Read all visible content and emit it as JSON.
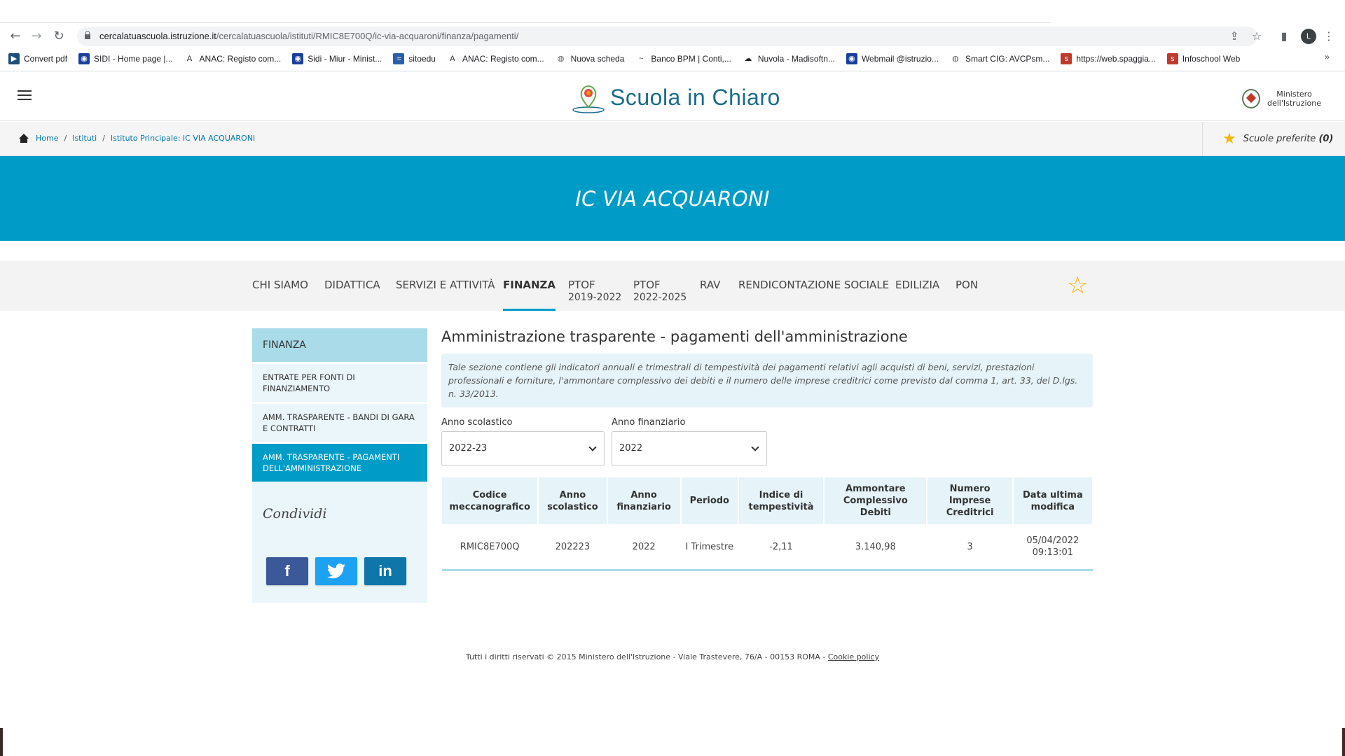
{
  "browser": {
    "url_host": "cercalatuascuola.istruzione.it",
    "url_path": "/cercalatuascuola/istituti/RMIC8E700Q/ic-via-acquaroni/finanza/pagamenti/",
    "profile_initial": "L",
    "bookmarks": [
      {
        "label": "Convert pdf",
        "icon": "convert-pdf-icon",
        "color": "#1f4e79"
      },
      {
        "label": "SIDI - Home page |...",
        "icon": "sidi-icon",
        "color": "#1a3f9a"
      },
      {
        "label": "ANAC: Registo com...",
        "icon": "anac-icon",
        "color": "#222222"
      },
      {
        "label": "Sidi - Miur - Minist...",
        "icon": "sidi-icon",
        "color": "#1a3f9a"
      },
      {
        "label": "sitoedu",
        "icon": "sitoedu-icon",
        "color": "#2a5ea8"
      },
      {
        "label": "ANAC: Registo com...",
        "icon": "anac-icon",
        "color": "#222222"
      },
      {
        "label": "Nuova scheda",
        "icon": "globe-icon",
        "color": "#5f6368"
      },
      {
        "label": "Banco BPM | Conti,...",
        "icon": "bpm-icon",
        "color": "#444444"
      },
      {
        "label": "Nuvola - Madisoftn...",
        "icon": "cloud-icon",
        "color": "#222222"
      },
      {
        "label": "Webmail @istruzio...",
        "icon": "webmail-icon",
        "color": "#1a3f9a"
      },
      {
        "label": "Smart CIG: AVCPsm...",
        "icon": "globe-icon",
        "color": "#5f6368"
      },
      {
        "label": "https://web.spaggia...",
        "icon": "spaggiari-icon",
        "color": "#c0392b"
      },
      {
        "label": "Infoschool Web",
        "icon": "infoschool-icon",
        "color": "#c0392b"
      }
    ]
  },
  "header": {
    "logo_text": "Scuola in Chiaro",
    "ministero_line1": "Ministero",
    "ministero_line2": "dell'Istruzione"
  },
  "breadcrumb": {
    "items": [
      "Home",
      "Istituti",
      "Istituto Principale: IC VIA ACQUARONI"
    ],
    "fav_label": "Scuole preferite",
    "fav_count": "(0)"
  },
  "banner": {
    "title": "IC VIA ACQUARONI"
  },
  "tabs": [
    {
      "label": "CHI SIAMO"
    },
    {
      "label": "DIDATTICA"
    },
    {
      "label": "SERVIZI E ATTIVITÀ"
    },
    {
      "label": "FINANZA"
    },
    {
      "label": "PTOF",
      "sub": "2019-2022"
    },
    {
      "label": "PTOF",
      "sub": "2022-2025"
    },
    {
      "label": "RAV"
    },
    {
      "label": "RENDICONTAZIONE SOCIALE"
    },
    {
      "label": "EDILIZIA"
    },
    {
      "label": "PON"
    }
  ],
  "sidebar": {
    "title": "FINANZA",
    "items": [
      {
        "label": "ENTRATE PER FONTI DI FINANZIAMENTO"
      },
      {
        "label": "AMM. TRASPARENTE - BANDI DI GARA E CONTRATTI"
      },
      {
        "label": "AMM. TRASPARENTE - PAGAMENTI DELL'AMMINISTRAZIONE"
      }
    ],
    "share_title": "Condividi",
    "share": [
      {
        "label": "f",
        "color": "#3b5998"
      },
      {
        "label": "t",
        "color": "#1da1f2"
      },
      {
        "label": "in",
        "color": "#0e76a8"
      }
    ]
  },
  "main": {
    "title": "Amministrazione trasparente - pagamenti dell'amministrazione",
    "notice": "Tale sezione contiene gli indicatori annuali e trimestrali di tempestività dei pagamenti relativi agli acquisti di beni, servizi, prestazioni professionali e forniture, l'ammontare complessivo dei debiti e il numero delle imprese creditrici come previsto dal comma 1, art. 33, del D.lgs. n. 33/2013.",
    "filter_anno_scolastico_label": "Anno scolastico",
    "filter_anno_scolastico_value": "2022-23",
    "filter_anno_finanziario_label": "Anno finanziario",
    "filter_anno_finanziario_value": "2022",
    "table": {
      "headers": [
        "Codice meccanografico",
        "Anno scolastico",
        "Anno finanziario",
        "Periodo",
        "Indice di tempestività",
        "Ammontare Complessivo Debiti",
        "Numero Imprese Creditrici",
        "Data ultima modifica"
      ],
      "rows": [
        [
          "RMIC8E700Q",
          "202223",
          "2022",
          "I Trimestre",
          "-2,11",
          "3.140,98",
          "3",
          "05/04/2022 09:13:01"
        ]
      ]
    }
  },
  "footer": {
    "text": "Tutti i diritti riservati © 2015 Ministero dell'Istruzione - Viale Trastevere, 76/A - 00153 ROMA - ",
    "link": "Cookie policy"
  },
  "colors": {
    "accent": "#009cc8",
    "sidebar_head": "#a9dbe8",
    "star": "#f2b705"
  }
}
